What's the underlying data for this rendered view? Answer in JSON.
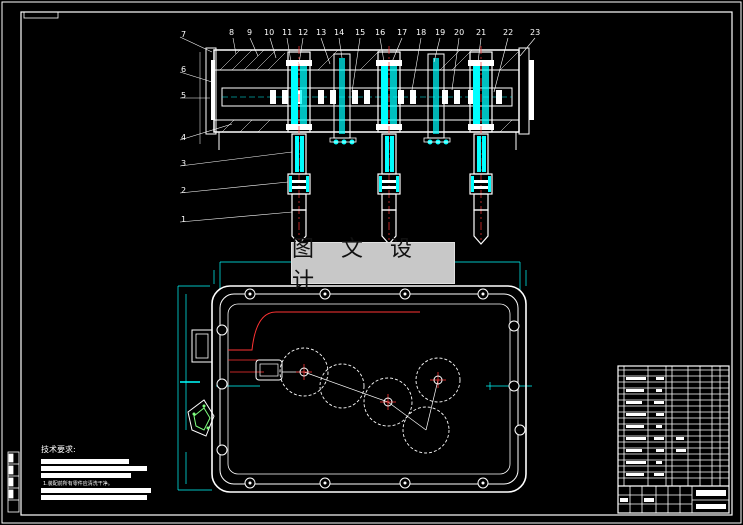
{
  "watermark": {
    "text": "图 文 设 计"
  },
  "part_numbers_left": [
    "7",
    "6",
    "5",
    "4",
    "3",
    "2",
    "1"
  ],
  "part_numbers_top": [
    "8",
    "9",
    "10",
    "11",
    "12",
    "13",
    "14",
    "15",
    "16",
    "17",
    "18",
    "19",
    "20",
    "21",
    "22",
    "23"
  ],
  "notes": {
    "title": "技术要求:",
    "line1": "1.装配前所有零件应清洗干净。"
  },
  "colors": {
    "background": "#000000",
    "line": "#ffffff",
    "cyan": "#00ffff",
    "red": "#ff3333",
    "watermark_bg": "#c8c8c8"
  }
}
